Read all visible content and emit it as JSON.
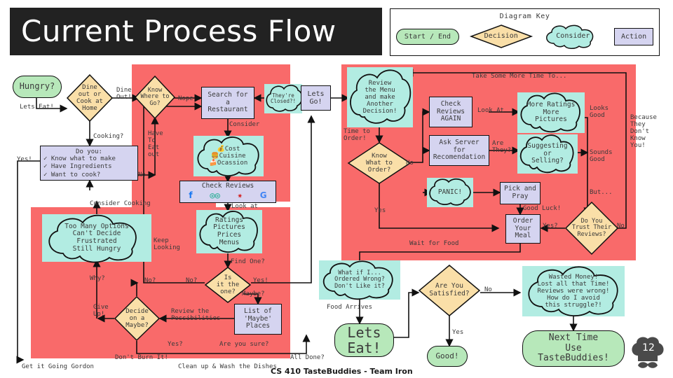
{
  "slide": {
    "title": "Current Process Flow",
    "page_number": "12",
    "footer": "CS 410 TasteBuddies - Team Iron",
    "logo": "chef-hat-mustache-icon"
  },
  "colors": {
    "highlight_red": "#f96a6a",
    "start_end_green": "#b7e8ba",
    "decision_orange": "#fadfa8",
    "consider_teal": "#b2ece2",
    "action_lavender": "#d5d4f0",
    "banner_black": "#222222",
    "outline": "#111111",
    "text": "#3a3a3a"
  },
  "key": {
    "title": "Diagram Key",
    "items": [
      {
        "label": "Start / End",
        "shape": "rounded-rectangle"
      },
      {
        "label": "Decision",
        "shape": "diamond"
      },
      {
        "label": "Consider",
        "shape": "cloud"
      },
      {
        "label": "Action",
        "shape": "rectangle"
      }
    ]
  },
  "nodes": {
    "hungry": "Hungry?",
    "dine_or_cook": "Dine\nout or\nCook at\nHome",
    "do_you": {
      "heading": "Do you:",
      "items": [
        "Know what to make",
        "Have Ingredients",
        "Want to cook?"
      ]
    },
    "too_many_options": "Too Many Options\nCan't Decide\nFrustrated\nStill Hungry",
    "know_where": "Know\nWhere to\nGo?",
    "search_restaurant": "Search for\na\nRestaurant",
    "theyre_closed": "They're\nClosed?!",
    "cost_cuisine": {
      "items": [
        "Cost",
        "Cuisine",
        "Ocassion"
      ],
      "icons": [
        "piggy-bank-icon",
        "burger-icon",
        "cake-icon"
      ]
    },
    "check_reviews": {
      "label": "Check Reviews",
      "logos": [
        "facebook-icon",
        "tripadvisor-icon",
        "yelp-icon",
        "google-icon"
      ]
    },
    "ratings_pictures": "Ratings\nPictures\nPrices\nMenus",
    "is_it_the_one": "Is\nit the\none?",
    "list_maybe": "List of\n'Maybe'\nPlaces",
    "decide_maybe": "Decide\non a\nMaybe?",
    "lets_go": "Lets\nGo!",
    "review_menu": "Review\nthe Menu\nand make\nAnother\nDecision!",
    "know_what_order": "Know\nWhat to\nOrder?",
    "check_reviews_again": "Check\nReviews\nAGAIN",
    "ask_server": "Ask Server\nfor\nRecomendation",
    "panic": "PANIC!",
    "more_ratings": "More Ratings\nMore\nPictures",
    "suggesting_selling": "Suggesting\nor\nSelling?",
    "pick_and_pray": "Pick and\nPray",
    "order_your_meal": "Order\nYour\nMeal",
    "do_you_trust": "Do You\nTrust Their\nReviews?",
    "what_if_i": "What if I...\nOrdered Wrong?\nDon't Like it?",
    "lets_eat_end": "Lets\nEat!",
    "are_you_satisfied": "Are You\nSatisfied?",
    "good": "Good!",
    "wasted_money": "Wasted Money!\nLost all that Time!\nReviews were wrong!\nHow do I avoid\nthis struggle?!",
    "next_time": "Next Time\nUse\nTasteBuddies!"
  },
  "edges": {
    "lets_eat": "Lets Eat!",
    "dine_out": "Dine\nOut!",
    "cooking": "Cooking?",
    "yes_excl": "Yes!",
    "consider_cooking": "Consider Cooking",
    "why": "Why?",
    "give_up": "Give\nUp!",
    "have_to_eat_out": "Have\nTo\nEat\nout",
    "no_left": "No",
    "nope": "Nope",
    "consider": "Consider",
    "look_at": "Look at",
    "keep_looking": "Keep\nLooking",
    "find_one": "Find One?",
    "no_q_left": "No?",
    "no_q_right": "No?",
    "yes_excl2": "Yes!",
    "maybe_q": "Maybe?",
    "review_possibilities": "Review the\nPossibilities",
    "yes_q": "Yes?",
    "are_you_sure": "Are you sure?",
    "dont_burn_it": "Don't Burn It!",
    "all_done": "All Done?",
    "get_it_going_gordon": "Get it Going Gordon",
    "clean_up": "Clean up & Wash the Dishes",
    "take_some_more_time": "Take Some More Time To...",
    "time_to_order": "Time to\nOrder!",
    "no_order": "No",
    "yes_order": "Yes",
    "look_at_cap": "Look At",
    "are_they": "Are\nThey?",
    "looks_good": "Looks\nGood",
    "sounds_good": "Sounds\nGood",
    "but": "But...",
    "because_they": "Because\nThey\nDon't\nKnow\nYou!",
    "good_luck": "Good Luck!",
    "yes_q_trust": "Yes?",
    "no_trust": "No",
    "wait_for_food": "Wait for Food",
    "food_arrives": "Food Arrives",
    "no_satisfied": "No",
    "yes_satisfied": "Yes"
  }
}
